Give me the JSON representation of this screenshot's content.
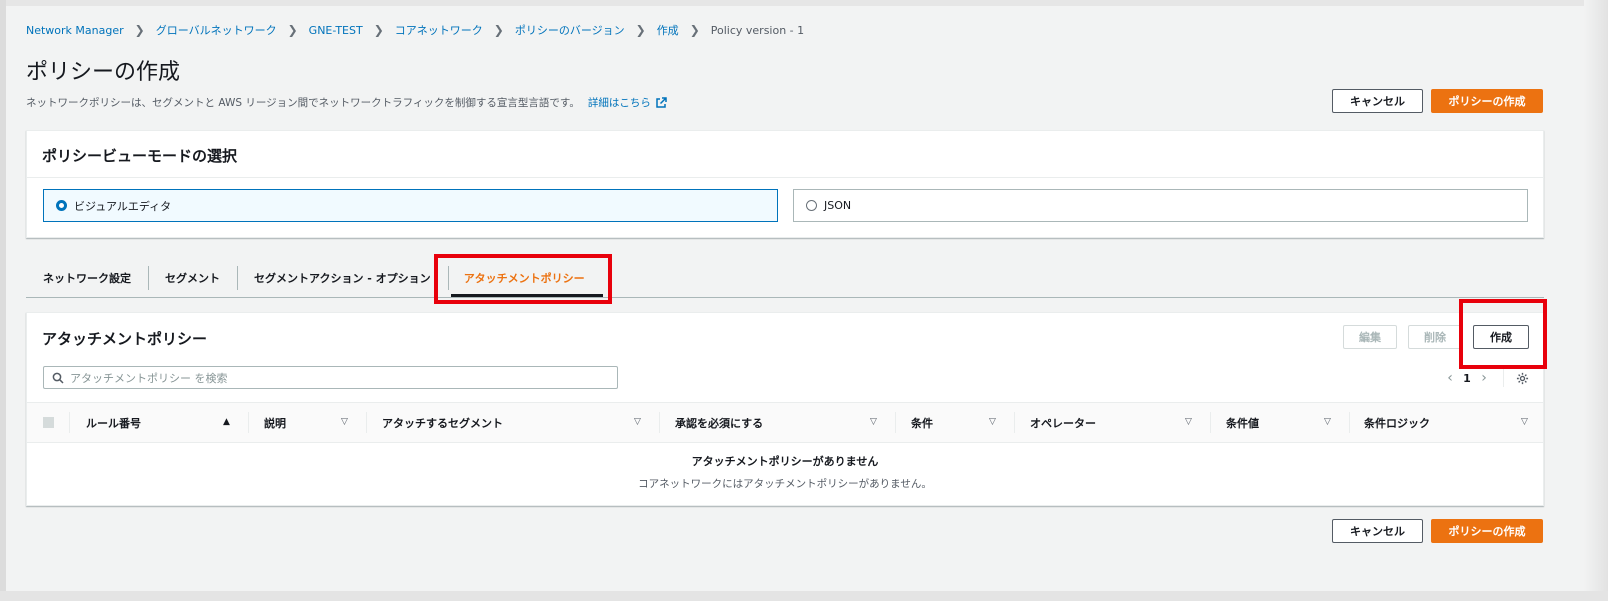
{
  "breadcrumb": {
    "items": [
      "Network Manager",
      "グローバルネットワーク",
      "GNE-TEST",
      "コアネットワーク",
      "ポリシーのバージョン",
      "作成"
    ],
    "current": "Policy version - 1"
  },
  "page": {
    "title": "ポリシーの作成",
    "description": "ネットワークポリシーは、セグメントと AWS リージョン間でネットワークトラフィックを制御する宣言型言語です。",
    "learn_more": "詳細はこちら"
  },
  "actions": {
    "cancel": "キャンセル",
    "create_policy": "ポリシーの作成"
  },
  "view_mode": {
    "heading": "ポリシービューモードの選択",
    "options": [
      {
        "label": "ビジュアルエディタ",
        "selected": true
      },
      {
        "label": "JSON",
        "selected": false
      }
    ]
  },
  "tabs": [
    {
      "label": "ネットワーク設定",
      "active": false
    },
    {
      "label": "セグメント",
      "active": false
    },
    {
      "label": "セグメントアクション - オプション",
      "active": false
    },
    {
      "label": "アタッチメントポリシー",
      "active": true
    }
  ],
  "attachment_policies": {
    "heading": "アタッチメントポリシー",
    "buttons": {
      "edit": "編集",
      "delete": "削除",
      "create": "作成"
    },
    "search_placeholder": "アタッチメントポリシー を検索",
    "pagination": {
      "page": "1"
    },
    "columns": [
      "ルール番号",
      "説明",
      "アタッチするセグメント",
      "承認を必須にする",
      "条件",
      "オペレーター",
      "条件値",
      "条件ロジック"
    ],
    "rows": [],
    "empty_title": "アタッチメントポリシーがありません",
    "empty_desc": "コアネットワークにはアタッチメントポリシーがありません。"
  },
  "colors": {
    "accent": "#ec7211",
    "link": "#0073bb",
    "highlight": "#e8000b"
  }
}
